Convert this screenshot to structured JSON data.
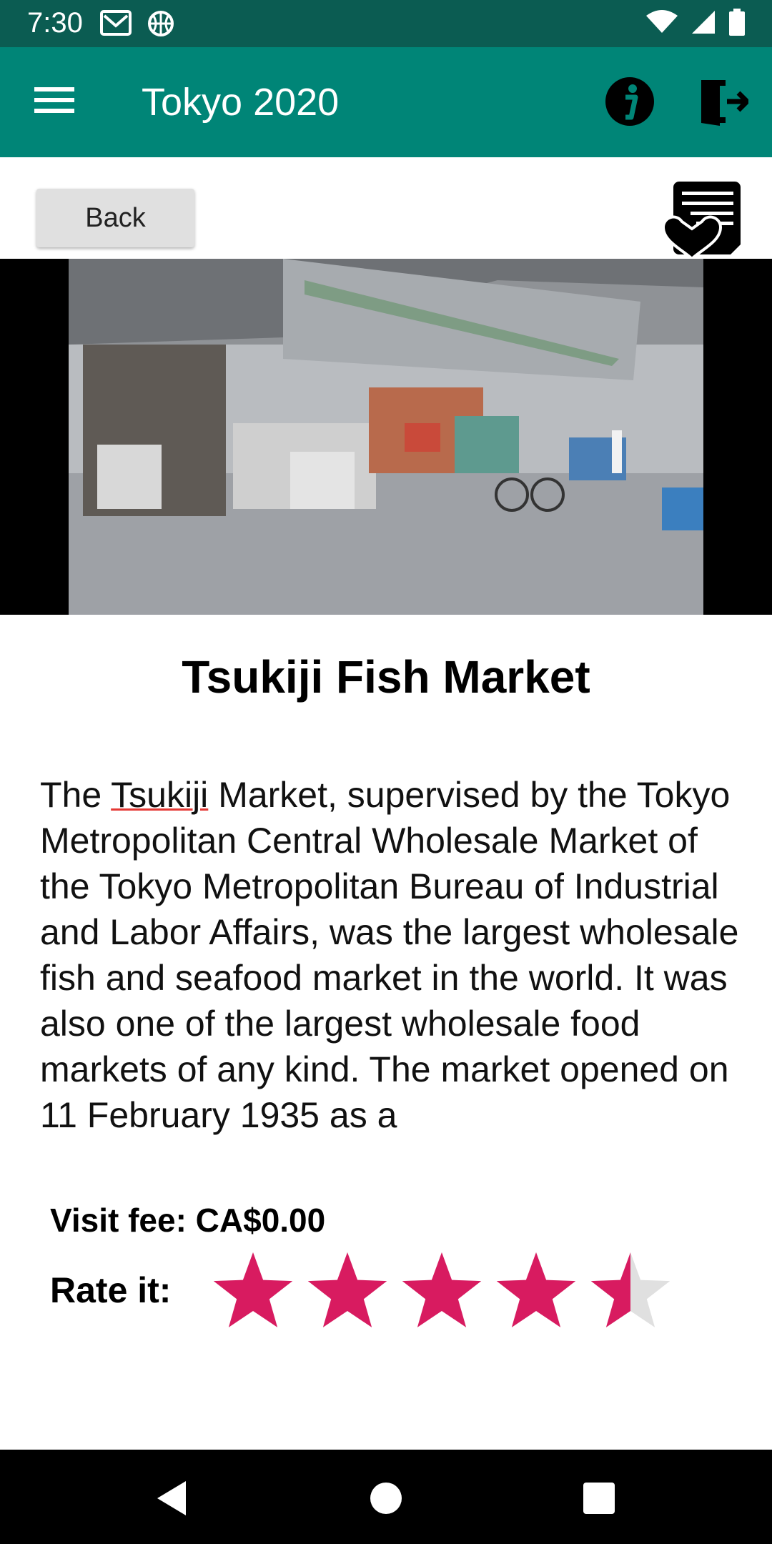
{
  "status_bar": {
    "time": "7:30",
    "left_icons": [
      "gmail-icon",
      "basketball-icon"
    ],
    "right_icons": [
      "wifi-icon",
      "signal-icon",
      "battery-icon"
    ]
  },
  "app_bar": {
    "title": "Tokyo 2020",
    "color": "#008577",
    "icons": [
      "menu-icon",
      "info-icon",
      "exit-icon"
    ]
  },
  "actions": {
    "back_label": "Back",
    "favorite_icon": "favorite-list-icon"
  },
  "place": {
    "title": "Tsukiji Fish Market",
    "description_before": "The ",
    "description_flagged_word": "Tsukiji",
    "description_after": " Market, supervised by the Tokyo Metropolitan Central Wholesale Market of the Tokyo Metropolitan Bureau of Industrial and Labor Affairs, was the largest wholesale fish and seafood market in the world. It was also one of the largest wholesale food markets of any kind. The market opened on 11 February 1935 as a",
    "fee": "Visit fee: CA$0.00"
  },
  "rating": {
    "label": "Rate it:",
    "value": 4.5,
    "max": 5,
    "star_color": "#d81b60",
    "empty_color": "#e0e0e0"
  },
  "nav_bar": {
    "icons": [
      "back-triangle-icon",
      "home-circle-icon",
      "recents-square-icon"
    ]
  }
}
